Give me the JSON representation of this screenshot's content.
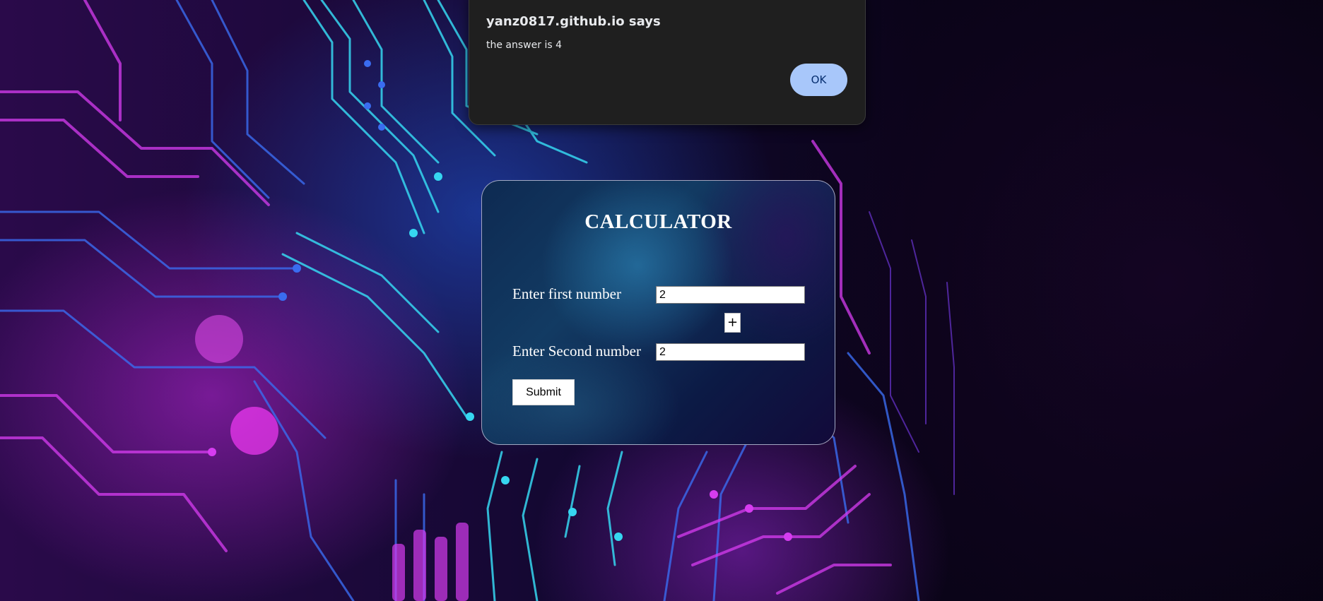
{
  "alert": {
    "origin": "yanz0817.github.io says",
    "message": "the answer is 4",
    "ok_label": "OK"
  },
  "calculator": {
    "title": "CALCULATOR",
    "first_label": "Enter first number",
    "first_value": "2",
    "operator": "+",
    "second_label": "Enter Second number",
    "second_value": "2",
    "submit_label": "Submit"
  },
  "colors": {
    "alert_bg": "#1f1f1f",
    "ok_button": "#a8c7fa",
    "circuit_cyan": "#36d6f0",
    "circuit_magenta": "#d63cf0",
    "circuit_blue": "#3a6cf0"
  }
}
